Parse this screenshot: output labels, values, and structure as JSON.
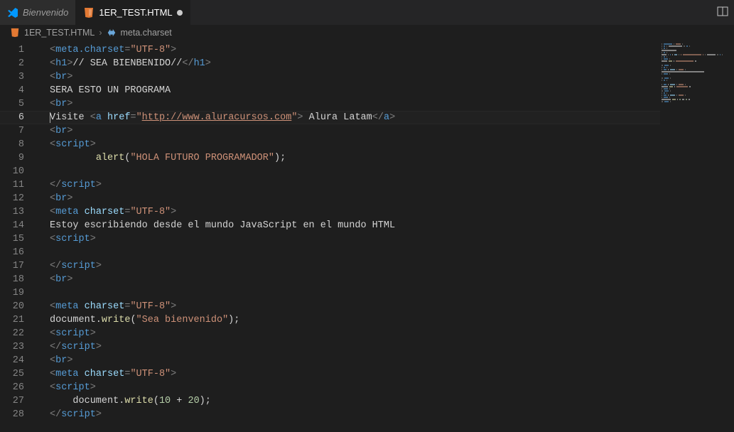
{
  "tabs": [
    {
      "label": "Bienvenido",
      "active": false,
      "icon": "vscode"
    },
    {
      "label": "1ER_TEST.HTML",
      "active": true,
      "icon": "html",
      "dirty": true
    }
  ],
  "breadcrumb": {
    "file_icon": "html",
    "file": "1ER_TEST.HTML",
    "symbol_icon": "brackets",
    "symbol": "meta.charset"
  },
  "active_line": 6,
  "code_lines": [
    {
      "n": 1,
      "tokens": [
        [
          "punc",
          "<"
        ],
        [
          "tag",
          "meta.charset"
        ],
        [
          "punc",
          "="
        ],
        [
          "str",
          "\"UTF-8\""
        ],
        [
          "punc",
          ">"
        ]
      ]
    },
    {
      "n": 2,
      "tokens": [
        [
          "punc",
          "<"
        ],
        [
          "tag",
          "h1"
        ],
        [
          "punc",
          ">"
        ],
        [
          "text",
          "// SEA BIENBENIDO//"
        ],
        [
          "punc",
          "</"
        ],
        [
          "tag",
          "h1"
        ],
        [
          "punc",
          ">"
        ]
      ]
    },
    {
      "n": 3,
      "tokens": [
        [
          "punc",
          "<"
        ],
        [
          "tag",
          "br"
        ],
        [
          "punc",
          ">"
        ]
      ]
    },
    {
      "n": 4,
      "tokens": [
        [
          "text",
          "SERA ESTO UN PROGRAMA"
        ]
      ]
    },
    {
      "n": 5,
      "tokens": [
        [
          "punc",
          "<"
        ],
        [
          "tag",
          "br"
        ],
        [
          "punc",
          ">"
        ]
      ]
    },
    {
      "n": 6,
      "tokens": [
        [
          "cursor",
          ""
        ],
        [
          "text",
          "Visite "
        ],
        [
          "punc",
          "<"
        ],
        [
          "tag",
          "a"
        ],
        [
          "text",
          " "
        ],
        [
          "attr",
          "href"
        ],
        [
          "punc",
          "="
        ],
        [
          "str",
          "\""
        ],
        [
          "link",
          "http://www.aluracursos.com"
        ],
        [
          "str",
          "\""
        ],
        [
          "punc",
          ">"
        ],
        [
          "text",
          " Alura Latam"
        ],
        [
          "punc",
          "</"
        ],
        [
          "tag",
          "a"
        ],
        [
          "punc",
          ">"
        ]
      ]
    },
    {
      "n": 7,
      "tokens": [
        [
          "punc",
          "<"
        ],
        [
          "tag",
          "br"
        ],
        [
          "punc",
          ">"
        ]
      ]
    },
    {
      "n": 8,
      "tokens": [
        [
          "punc",
          "<"
        ],
        [
          "tag",
          "script"
        ],
        [
          "punc",
          ">"
        ]
      ]
    },
    {
      "n": 9,
      "tokens": [
        [
          "text",
          "        "
        ],
        [
          "func",
          "alert"
        ],
        [
          "text",
          "("
        ],
        [
          "str",
          "\"HOLA FUTURO PROGRAMADOR\""
        ],
        [
          "text",
          ");"
        ]
      ]
    },
    {
      "n": 10,
      "tokens": []
    },
    {
      "n": 11,
      "tokens": [
        [
          "punc",
          "</"
        ],
        [
          "tag",
          "script"
        ],
        [
          "punc",
          ">"
        ]
      ]
    },
    {
      "n": 12,
      "tokens": [
        [
          "punc",
          "<"
        ],
        [
          "tag",
          "br"
        ],
        [
          "punc",
          ">"
        ]
      ]
    },
    {
      "n": 13,
      "tokens": [
        [
          "punc",
          "<"
        ],
        [
          "tag",
          "meta"
        ],
        [
          "text",
          " "
        ],
        [
          "attr",
          "charset"
        ],
        [
          "punc",
          "="
        ],
        [
          "str",
          "\"UTF-8\""
        ],
        [
          "punc",
          ">"
        ]
      ]
    },
    {
      "n": 14,
      "tokens": [
        [
          "text",
          "Estoy escribiendo desde el mundo JavaScript en el mundo HTML"
        ]
      ]
    },
    {
      "n": 15,
      "tokens": [
        [
          "punc",
          "<"
        ],
        [
          "tag",
          "script"
        ],
        [
          "punc",
          ">"
        ]
      ]
    },
    {
      "n": 16,
      "tokens": []
    },
    {
      "n": 17,
      "tokens": [
        [
          "punc",
          "</"
        ],
        [
          "tag",
          "script"
        ],
        [
          "punc",
          ">"
        ]
      ]
    },
    {
      "n": 18,
      "tokens": [
        [
          "punc",
          "<"
        ],
        [
          "tag",
          "br"
        ],
        [
          "punc",
          ">"
        ]
      ]
    },
    {
      "n": 19,
      "tokens": []
    },
    {
      "n": 20,
      "tokens": [
        [
          "punc",
          "<"
        ],
        [
          "tag",
          "meta"
        ],
        [
          "text",
          " "
        ],
        [
          "attr",
          "charset"
        ],
        [
          "punc",
          "="
        ],
        [
          "str",
          "\"UTF-8\""
        ],
        [
          "punc",
          ">"
        ]
      ]
    },
    {
      "n": 21,
      "tokens": [
        [
          "text",
          "document."
        ],
        [
          "func",
          "write"
        ],
        [
          "text",
          "("
        ],
        [
          "str",
          "\"Sea bienvenido\""
        ],
        [
          "text",
          ");"
        ]
      ]
    },
    {
      "n": 22,
      "tokens": [
        [
          "punc",
          "<"
        ],
        [
          "tag",
          "script"
        ],
        [
          "punc",
          ">"
        ]
      ]
    },
    {
      "n": 23,
      "tokens": [
        [
          "punc",
          "</"
        ],
        [
          "tag",
          "script"
        ],
        [
          "punc",
          ">"
        ]
      ]
    },
    {
      "n": 24,
      "tokens": [
        [
          "punc",
          "<"
        ],
        [
          "tag",
          "br"
        ],
        [
          "punc",
          ">"
        ]
      ]
    },
    {
      "n": 25,
      "tokens": [
        [
          "punc",
          "<"
        ],
        [
          "tag",
          "meta"
        ],
        [
          "text",
          " "
        ],
        [
          "attr",
          "charset"
        ],
        [
          "punc",
          "="
        ],
        [
          "str",
          "\"UTF-8\""
        ],
        [
          "punc",
          ">"
        ]
      ]
    },
    {
      "n": 26,
      "tokens": [
        [
          "punc",
          "<"
        ],
        [
          "tag",
          "script"
        ],
        [
          "punc",
          ">"
        ]
      ]
    },
    {
      "n": 27,
      "tokens": [
        [
          "text",
          "    document."
        ],
        [
          "func",
          "write"
        ],
        [
          "text",
          "("
        ],
        [
          "num",
          "10"
        ],
        [
          "text",
          " + "
        ],
        [
          "num",
          "20"
        ],
        [
          "text",
          ");"
        ]
      ]
    },
    {
      "n": 28,
      "tokens": [
        [
          "punc",
          "</"
        ],
        [
          "tag",
          "script"
        ],
        [
          "punc",
          ">"
        ]
      ]
    }
  ],
  "token_colors": {
    "punc": "#808080",
    "tag": "#569cd6",
    "attr": "#9cdcfe",
    "str": "#ce9178",
    "text": "#d4d4d4",
    "func": "#dcdcaa",
    "num": "#b5cea8",
    "link": "#ce9178"
  }
}
